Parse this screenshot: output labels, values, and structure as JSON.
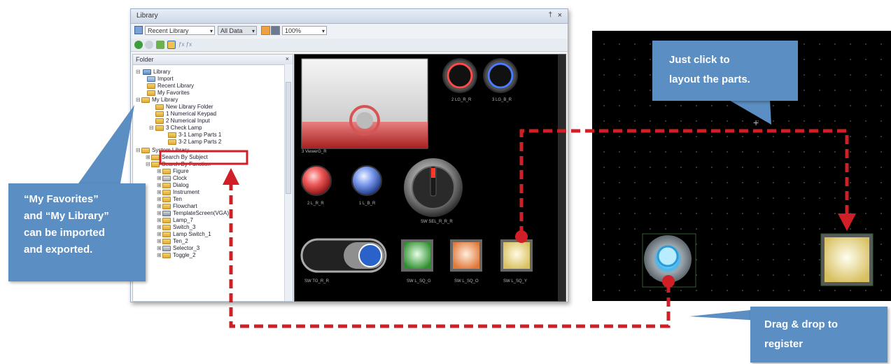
{
  "window": {
    "title": "Library",
    "pin_glyph": "†",
    "close_glyph": "×",
    "toolbar": {
      "library_combo": "Recent Library",
      "data_combo": "All Data",
      "zoom_combo": "100%"
    },
    "folder_pane": {
      "title": "Folder",
      "close_glyph": "×",
      "items": [
        {
          "label": "Library"
        },
        {
          "label": "Import"
        },
        {
          "label": "Recent Library"
        },
        {
          "label": "My Favorites"
        },
        {
          "label": "My Library"
        },
        {
          "label": "New Library Folder"
        },
        {
          "label": "1 Numerical Keypad"
        },
        {
          "label": "2 Numerical Input"
        },
        {
          "label": "3 Check Lamp"
        },
        {
          "label": "3-1 Lamp Parts 1"
        },
        {
          "label": "3-2 Lamp Parts 2"
        },
        {
          "label": "System Library"
        },
        {
          "label": "Search By Subject"
        },
        {
          "label": "Search By Function"
        },
        {
          "label": "Figure"
        },
        {
          "label": "Clock"
        },
        {
          "label": "Dialog"
        },
        {
          "label": "Instrument"
        },
        {
          "label": "Ten"
        },
        {
          "label": "Flowchart"
        },
        {
          "label": "TemplateScreen(VGA)"
        },
        {
          "label": "Lamp_7"
        },
        {
          "label": "Switch_3"
        },
        {
          "label": "Lamp Switch_1"
        },
        {
          "label": "Ten_2"
        },
        {
          "label": "Selector_3"
        },
        {
          "label": "Toggle_2"
        }
      ]
    },
    "parts": {
      "labels": {
        "viewer": "3 ViewerG_R",
        "red_ring": "2 LG_R_R",
        "blue_ring": "3 LG_B_R",
        "red_lamp": "2 L_R_R",
        "blue_lamp": "1 L_B_R",
        "selector": "SW SEL_R_R_R",
        "toggle": "SW TG_R_R",
        "green_sq": "SW L_SQ_G",
        "orange_sq": "SW L_SQ_O",
        "yellow_sq": "SW L_SQ_Y"
      }
    }
  },
  "callouts": {
    "left": {
      "lines": [
        "“My Favorites”",
        "and “My Library”",
        "can be imported",
        "and exported."
      ]
    },
    "top_right": {
      "lines": [
        "Just click to",
        "layout the parts."
      ]
    },
    "bottom_right": {
      "lines": [
        "Drag & drop to",
        "register"
      ]
    }
  },
  "colors": {
    "callout": "#5b8ec2",
    "arrow": "#d01f26",
    "highlight_box": "#d01f26"
  }
}
